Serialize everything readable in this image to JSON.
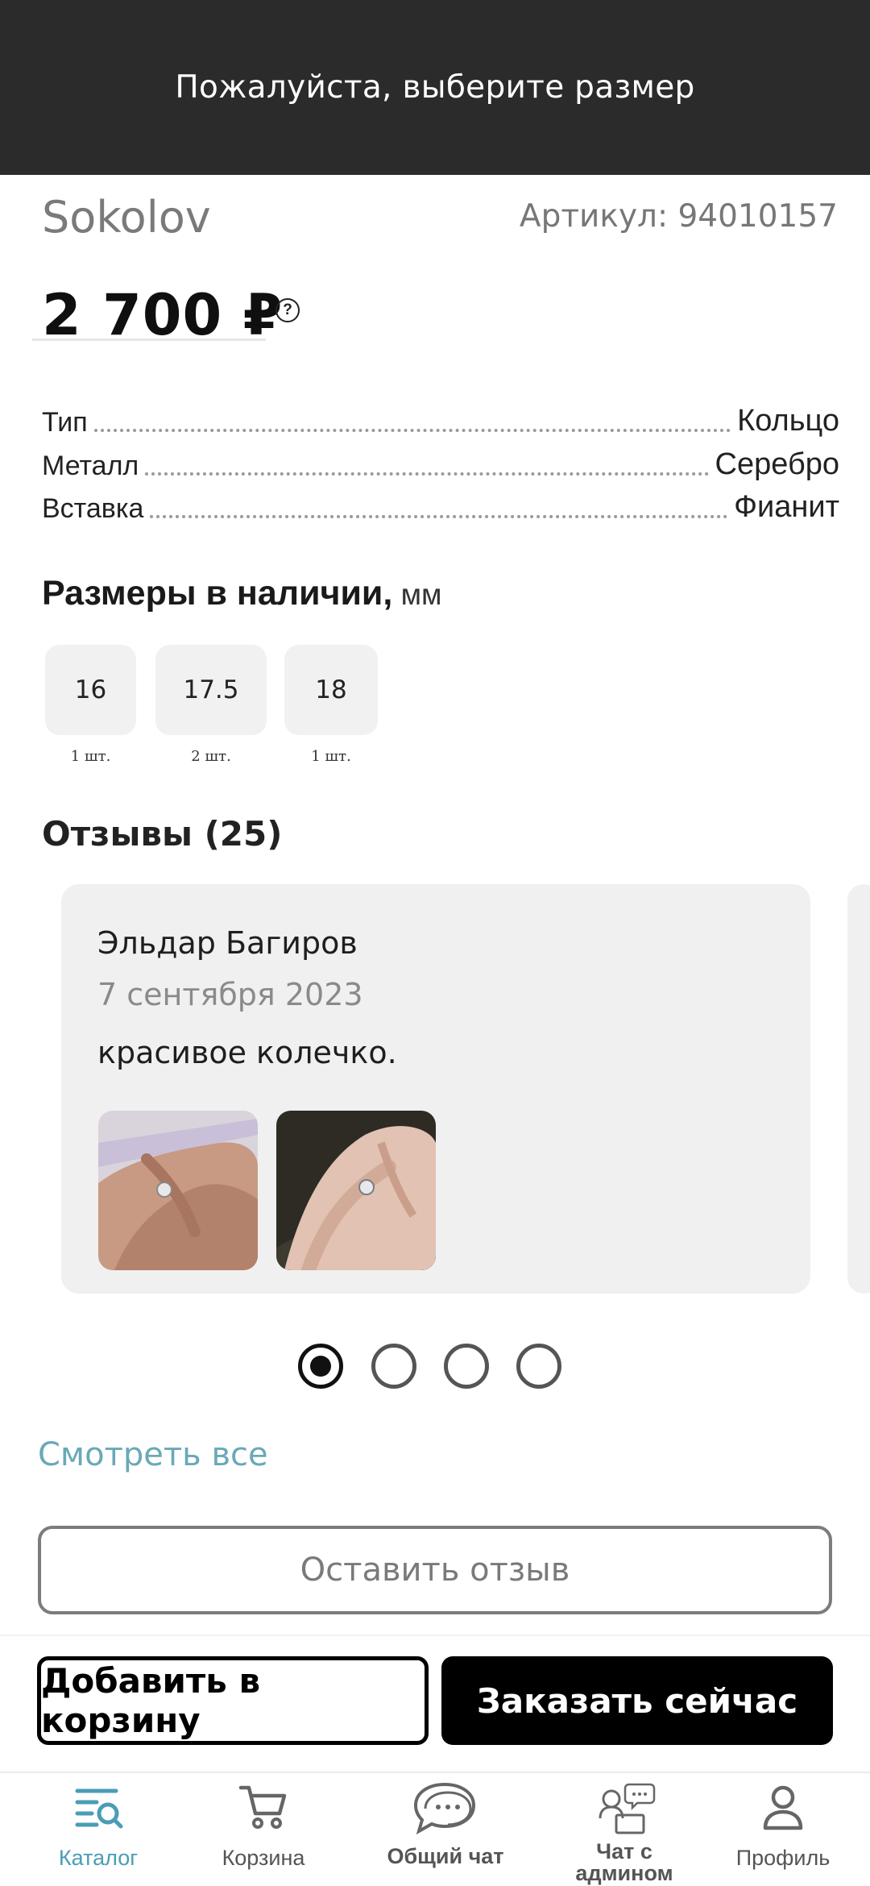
{
  "toast": {
    "message": "Пожалуйста, выберите размер"
  },
  "product": {
    "brand": "Sokolov",
    "article": "Артикул: 94010157",
    "price": "2 700 ₽",
    "help_icon": "question-circle-icon"
  },
  "specs": [
    {
      "key": "Тип",
      "value": "Кольцо"
    },
    {
      "key": "Металл",
      "value": "Серебро"
    },
    {
      "key": "Вставка",
      "value": "Фианит"
    }
  ],
  "sizes": {
    "title": "Размеры в наличии,",
    "unit": " мм",
    "items": [
      {
        "size": "16",
        "qty": "1 шт."
      },
      {
        "size": "17.5",
        "qty": "2 шт."
      },
      {
        "size": "18",
        "qty": "1 шт."
      }
    ]
  },
  "reviews": {
    "title": "Отзывы (25)",
    "current": {
      "author": "Эльдар Багиров",
      "date": "7 сентября 2023",
      "text": "красивое колечко.",
      "photos": [
        "ring-on-hand-photo",
        "ring-on-hand-photo"
      ]
    },
    "pagination": {
      "total": 4,
      "active": 1
    },
    "see_all": "Смотреть все",
    "leave_review": "Оставить отзыв"
  },
  "actions": {
    "add_to_cart": "Добавить в корзину",
    "order_now": "Заказать сейчас"
  },
  "tabbar": {
    "active_color": "#4a9db5",
    "items": [
      {
        "label": "Каталог",
        "icon": "catalog-search-icon"
      },
      {
        "label": "Корзина",
        "icon": "cart-icon"
      },
      {
        "label": "Общий чат",
        "icon": "chat-bubble-icon"
      },
      {
        "label": "Чат с админом",
        "icon": "admin-chat-icon"
      },
      {
        "label": "Профиль",
        "icon": "profile-icon"
      }
    ]
  }
}
